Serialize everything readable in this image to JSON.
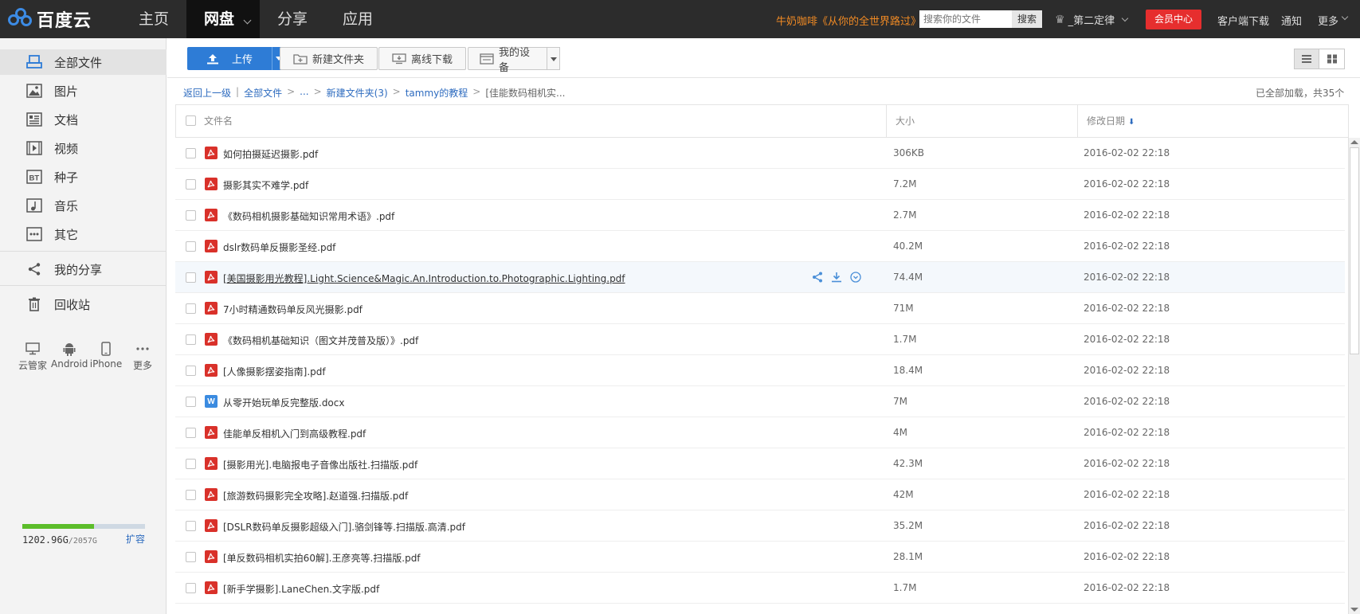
{
  "app": {
    "brand": "百度云",
    "nav": [
      "主页",
      "网盘",
      "分享",
      "应用"
    ],
    "promo": "牛奶咖啡《从你的全世界路过》",
    "search_placeholder": "搜索你的文件",
    "search_button": "搜索",
    "username": "_第二定律",
    "vip_button": "会员中心",
    "client_download": "客户端下载",
    "notify": "通知",
    "more": "更多"
  },
  "sidebar": {
    "items": [
      {
        "label": "全部文件",
        "icon": "all-files-icon"
      },
      {
        "label": "图片",
        "icon": "image-icon"
      },
      {
        "label": "文档",
        "icon": "document-icon"
      },
      {
        "label": "视频",
        "icon": "video-icon"
      },
      {
        "label": "种子",
        "icon": "bt-icon"
      },
      {
        "label": "音乐",
        "icon": "music-icon"
      },
      {
        "label": "其它",
        "icon": "other-icon"
      }
    ],
    "share": "我的分享",
    "recycle": "回收站",
    "devices": [
      "云管家",
      "Android",
      "iPhone",
      "更多"
    ],
    "quota_used": "1202.96G",
    "quota_total": "/2057G",
    "quota_fraction": 0.584,
    "expand": "扩容"
  },
  "toolbar": {
    "upload": "上传",
    "new_folder": "新建文件夹",
    "offline_download": "离线下载",
    "my_devices": "我的设备"
  },
  "breadcrumb": {
    "back": "返回上一级",
    "all": "全部文件",
    "ellipsis": "...",
    "folder1": "新建文件夹(3)",
    "folder2": "tammy的教程",
    "current": "[佳能数码相机实...",
    "loaded_status": "已全部加载，共35个"
  },
  "table": {
    "col_name": "文件名",
    "col_size": "大小",
    "col_date": "修改日期",
    "rows": [
      {
        "name": "如何拍摄延迟摄影.pdf",
        "size": "306KB",
        "date": "2016-02-02 22:18",
        "type": "pdf"
      },
      {
        "name": "摄影其实不难学.pdf",
        "size": "7.2M",
        "date": "2016-02-02 22:18",
        "type": "pdf"
      },
      {
        "name": "《数码相机摄影基础知识常用术语》.pdf",
        "size": "2.7M",
        "date": "2016-02-02 22:18",
        "type": "pdf"
      },
      {
        "name": "dslr数码单反摄影圣经.pdf",
        "size": "40.2M",
        "date": "2016-02-02 22:18",
        "type": "pdf"
      },
      {
        "name": "[美国摄影用光教程].Light.Science&Magic.An.Introduction.to.Photographic.Lighting.pdf",
        "size": "74.4M",
        "date": "2016-02-02 22:18",
        "type": "pdf"
      },
      {
        "name": "7小时精通数码单反风光摄影.pdf",
        "size": "71M",
        "date": "2016-02-02 22:18",
        "type": "pdf"
      },
      {
        "name": "《数码相机基础知识（图文并茂普及版）》.pdf",
        "size": "1.7M",
        "date": "2016-02-02 22:18",
        "type": "pdf"
      },
      {
        "name": "[人像摄影摆姿指南].pdf",
        "size": "18.4M",
        "date": "2016-02-02 22:18",
        "type": "pdf"
      },
      {
        "name": "从零开始玩单反完整版.docx",
        "size": "7M",
        "date": "2016-02-02 22:18",
        "type": "doc"
      },
      {
        "name": "佳能单反相机入门到高级教程.pdf",
        "size": "4M",
        "date": "2016-02-02 22:18",
        "type": "pdf"
      },
      {
        "name": "[摄影用光].电脑报电子音像出版社.扫描版.pdf",
        "size": "42.3M",
        "date": "2016-02-02 22:18",
        "type": "pdf"
      },
      {
        "name": "[旅游数码摄影完全攻略].赵道强.扫描版.pdf",
        "size": "42M",
        "date": "2016-02-02 22:18",
        "type": "pdf"
      },
      {
        "name": "[DSLR数码单反摄影超级入门].骆剑锋等.扫描版.高清.pdf",
        "size": "35.2M",
        "date": "2016-02-02 22:18",
        "type": "pdf"
      },
      {
        "name": "[单反数码相机实拍60解].王彦亮等.扫描版.pdf",
        "size": "28.1M",
        "date": "2016-02-02 22:18",
        "type": "pdf"
      },
      {
        "name": "[新手学摄影].LaneChen.文字版.pdf",
        "size": "1.7M",
        "date": "2016-02-02 22:18",
        "type": "pdf"
      }
    ]
  },
  "colors": {
    "topbar": "#2c2c2c",
    "accent_blue": "#2e7cd6",
    "vip_red": "#e62e2e",
    "pdf_red": "#d9312a",
    "quota_green": "#5cbd2a"
  }
}
